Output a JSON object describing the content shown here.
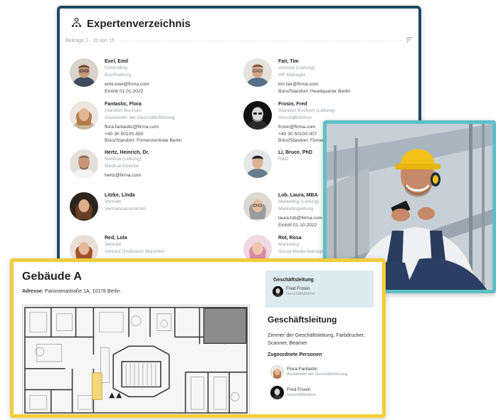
{
  "directory": {
    "title": "Expertenverzeichnis",
    "meta": "Beiträge 1 - 15 von 15",
    "icons": {
      "title": "expert-network-icon",
      "list": "list-sort-icon"
    },
    "people": [
      {
        "name": "Exel, Emil",
        "lines": [
          "Controlling",
          "Buchhaltung"
        ],
        "contact": [
          "emil.exel@firma.com",
          "Eintritt 01.01.2022"
        ]
      },
      {
        "name": "Fair, Tim",
        "lines": [
          "Vertrieb (Leitung)",
          "HR Manager"
        ],
        "contact": [
          "tim.fair@firma.com",
          "Büro/Standort: Headquarter Berlin"
        ]
      },
      {
        "name": "Fantastic, Flora",
        "lines": [
          "Standort Bochum",
          "Assistentin der Geschäftsführung"
        ],
        "contact": [
          "flora.fantastic@firma.com",
          "+40 30 50100-550",
          "Büro/Standort: Firmenzentrale Berlin"
        ]
      },
      {
        "name": "Frosin, Fred",
        "lines": [
          "Standort Bochum (Leitung)",
          "Geschäftsführer"
        ],
        "contact": [
          "frosin@firma.com",
          "+40 30 50100-007",
          "Büro/Standort: Firmen"
        ]
      },
      {
        "name": "Hertz, Heinrich, Dr.",
        "lines": [
          "Medical (Leitung)",
          "Medical Director"
        ],
        "contact": [
          "hertz@firma.com"
        ]
      },
      {
        "name": "Li, Bruce, PhD",
        "lines": [
          "R&D"
        ],
        "contact": []
      },
      {
        "name": "Litzke, Linda",
        "lines": [
          "Vertrieb",
          "Vertriebsassistentin"
        ],
        "contact": []
      },
      {
        "name": "Lob, Laura, MBA",
        "lines": [
          "Marketing (Leitung)",
          "Marketingleitung"
        ],
        "contact": [
          "laura.lob@firma.com",
          "Eintritt 01.10.2022"
        ]
      },
      {
        "name": "Red, Lola",
        "lines": [
          "Vertrieb",
          "Verkauf Großraum München"
        ],
        "contact": []
      },
      {
        "name": "Rot, Rosa",
        "lines": [
          "Marketing",
          "Social Media Manager"
        ],
        "contact": []
      }
    ]
  },
  "building": {
    "title": "Gebäude A",
    "address_label": "Adresse:",
    "address": "Panoramastraße 1A, 10178 Berlin",
    "popup": {
      "title": "Geschäftsleitung",
      "person": "Fred Frosin",
      "role": "Geschäftsführer"
    },
    "room_title": "Geschäftsleitung",
    "room_description": "Zimmer der Geschäftsleitung, Farbdrucker, Scanner, Beamer",
    "assigned_label": "Zugeordnete Personen",
    "assigned": [
      {
        "name": "Flora Fantastic",
        "role": "Assistentin der Geschäftsführung"
      },
      {
        "name": "Fred Frosin",
        "role": "Geschäftsführer"
      }
    ]
  },
  "colors": {
    "directory_border": "#1d4a63",
    "photo_border": "#5fbfc6",
    "building_border": "#f2cd3b",
    "popup_bg": "#dceaf1"
  }
}
